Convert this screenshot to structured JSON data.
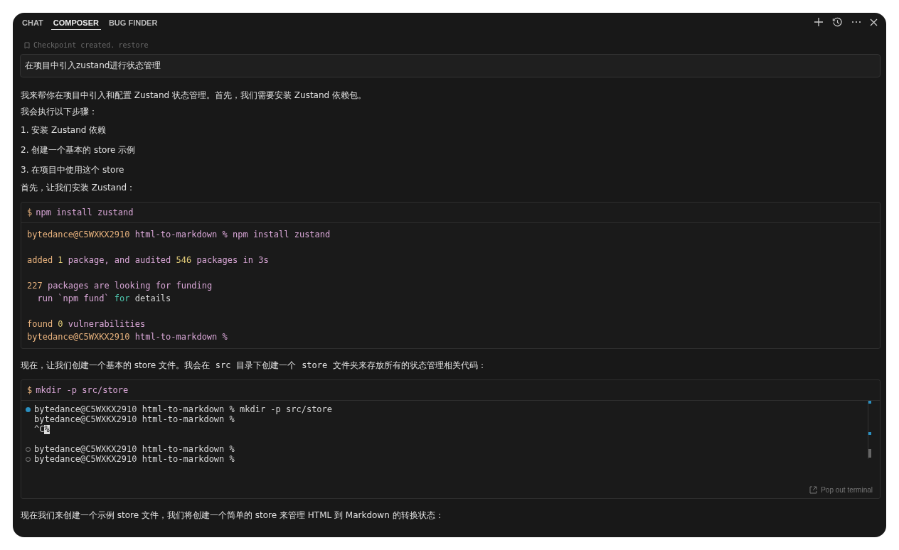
{
  "tabs": [
    {
      "label": "CHAT",
      "selected": false
    },
    {
      "label": "COMPOSER",
      "selected": true
    },
    {
      "label": "BUG FINDER",
      "selected": false
    }
  ],
  "checkpoint": {
    "text": "Checkpoint created.",
    "link": "restore"
  },
  "prompt": "在项目中引入zustand进行状态管理",
  "intro": [
    {
      "text": "我来帮你在项目中引入和配置 Zustand 状态管理。首先，我们需要安装 Zustand 依赖包。",
      "kind": "tight"
    },
    {
      "text": "我会执行以下步骤：",
      "kind": "tight"
    },
    {
      "text": "1. 安装 Zustand 依赖",
      "kind": "spaced"
    },
    {
      "text": "2. 创建一个基本的 store 示例",
      "kind": "spaced"
    },
    {
      "text": "3. 在项目中使用这个 store",
      "kind": "spaced"
    },
    {
      "text": "首先，让我们安装 Zustand：",
      "kind": "tight"
    }
  ],
  "terminal_1": {
    "prompt": "$",
    "command": "npm install zustand",
    "blocks": [
      [
        {
          "segments": [
            {
              "kind": "user",
              "text": "bytedance@C5WXKX2910"
            },
            {
              "kind": "text",
              "text": " html-to-markdown % npm install zustand"
            }
          ]
        }
      ],
      [
        {
          "segments": [
            {
              "kind": "user",
              "text": "added "
            },
            {
              "kind": "number",
              "text": "1"
            },
            {
              "kind": "text",
              "text": " package, and audited "
            },
            {
              "kind": "number",
              "text": "546"
            },
            {
              "kind": "text",
              "text": " packages in 3s"
            }
          ]
        }
      ],
      [
        {
          "segments": [
            {
              "kind": "user",
              "text": "227"
            },
            {
              "kind": "text",
              "text": " packages are looking for funding"
            }
          ]
        },
        {
          "segments": [
            {
              "kind": "text",
              "text": "  run `npm fund` "
            },
            {
              "kind": "keyword",
              "text": "for"
            },
            {
              "kind": "plain",
              "text": " details"
            }
          ]
        }
      ],
      [
        {
          "segments": [
            {
              "kind": "user",
              "text": "found "
            },
            {
              "kind": "number",
              "text": "0"
            },
            {
              "kind": "text",
              "text": " vulnerabilities"
            }
          ]
        },
        {
          "segments": [
            {
              "kind": "user",
              "text": "bytedance@C5WXKX2910"
            },
            {
              "kind": "text",
              "text": " html-to-markdown %"
            }
          ]
        }
      ]
    ]
  },
  "middle": [
    {
      "kind": "text",
      "text": "现在，让我们创建一个基本的 store 文件。我会在 "
    },
    {
      "kind": "code",
      "text": "src"
    },
    {
      "kind": "text",
      "text": " 目录下创建一个 "
    },
    {
      "kind": "code",
      "text": "store"
    },
    {
      "kind": "text",
      "text": " 文件夹来存放所有的状态管理相关代码："
    }
  ],
  "terminal_2": {
    "prompt": "$",
    "command": "mkdir -p src/store",
    "blocks": [
      [
        {
          "kind": "filled",
          "text": "bytedance@C5WXKX2910 html-to-markdown % mkdir -p src/store"
        },
        {
          "kind": "plain",
          "text": "bytedance@C5WXKX2910 html-to-markdown %"
        },
        {
          "kind": "plain",
          "text": "^C",
          "cursor": "%"
        }
      ],
      [
        {
          "kind": "hollow",
          "text": "bytedance@C5WXKX2910 html-to-markdown %"
        },
        {
          "kind": "hollow",
          "text": "bytedance@C5WXKX2910 html-to-markdown %"
        }
      ]
    ],
    "popout": "Pop out terminal"
  },
  "outro": "现在我们来创建一个示例 store 文件，我们将创建一个简单的 store 来管理 HTML 到 Markdown 的转换状态："
}
